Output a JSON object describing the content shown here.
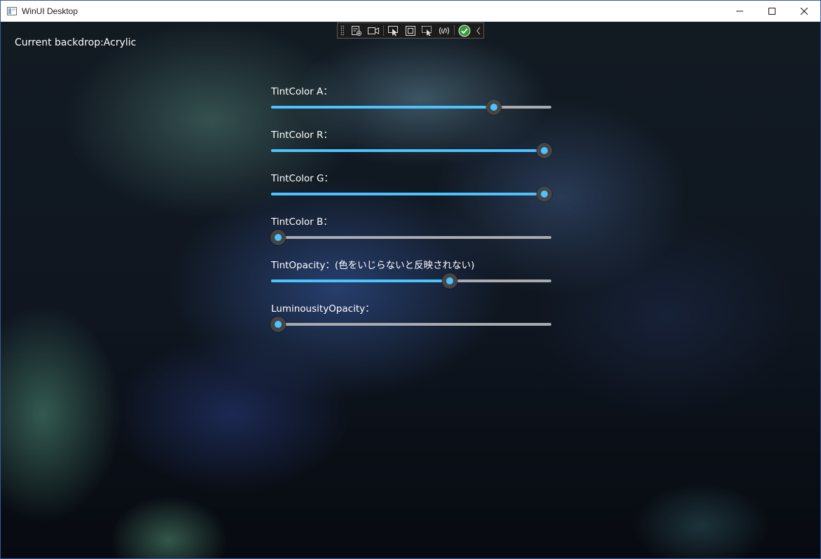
{
  "window": {
    "title": "WinUI Desktop"
  },
  "debug_toolbar": {
    "tools": [
      "live-visual-tree-icon",
      "record-icon",
      "select-element-icon",
      "display-layout-adorners-icon",
      "track-focus-icon",
      "binding-failures-icon",
      "hot-reload-ok-icon",
      "collapse-icon"
    ]
  },
  "backdrop": {
    "label": "Current backdrop:Acrylic"
  },
  "sliders": [
    {
      "label": "TintColor A：",
      "value": 0.81
    },
    {
      "label": "TintColor R：",
      "value": 1.0
    },
    {
      "label": "TintColor G：",
      "value": 1.0
    },
    {
      "label": "TintColor B：",
      "value": 0.0
    },
    {
      "label": "TintOpacity：(色をいじらないと反映されない)",
      "value": 0.645
    },
    {
      "label": "LuminousityOpacity：",
      "value": 0.0
    }
  ],
  "colors": {
    "accent": "#4cc2ff",
    "track": "#a8abb0",
    "thumb": "#454545"
  }
}
